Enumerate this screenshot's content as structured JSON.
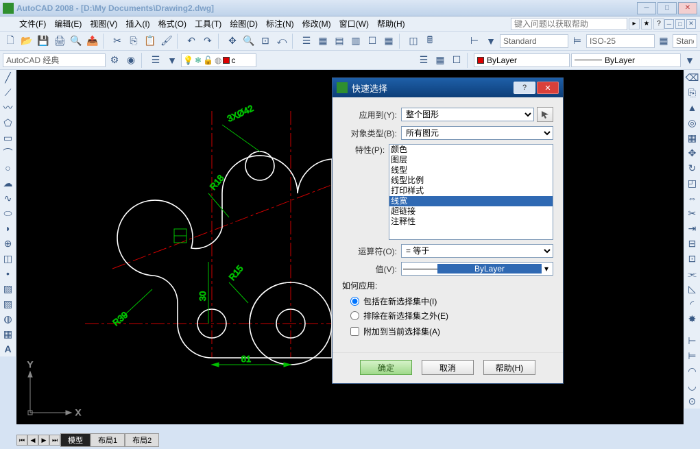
{
  "app": {
    "title": "AutoCAD 2008 - [D:\\My Documents\\Drawing2.dwg]"
  },
  "menu": {
    "items": [
      "文件(F)",
      "编辑(E)",
      "视图(V)",
      "插入(I)",
      "格式(O)",
      "工具(T)",
      "绘图(D)",
      "标注(N)",
      "修改(M)",
      "窗口(W)",
      "帮助(H)"
    ],
    "search_placeholder": "键入问题以获取帮助"
  },
  "toolbar2": {
    "workspace": "AutoCAD 经典",
    "layer_combo": "c",
    "bylayer1": "ByLayer",
    "bylayer2": "ByLayer"
  },
  "toolbar_right": {
    "style1": "Standard",
    "style2": "ISO-25",
    "style3": "Stand"
  },
  "tabs": {
    "model": "模型",
    "layout1": "布局1",
    "layout2": "布局2"
  },
  "drawing": {
    "axis_x": "X",
    "axis_y": "Y",
    "dim1": "81",
    "dim2": "30",
    "dim3": "3XØ42",
    "r18": "R18",
    "r15": "R15",
    "r39": "R39"
  },
  "dialog": {
    "title": "快速选择",
    "apply_to_label": "应用到(Y):",
    "apply_to_value": "整个图形",
    "obj_type_label": "对象类型(B):",
    "obj_type_value": "所有图元",
    "prop_label": "特性(P):",
    "props": [
      "颜色",
      "图层",
      "线型",
      "线型比例",
      "打印样式",
      "线宽",
      "超链接",
      "注释性"
    ],
    "props_selected_index": 5,
    "operator_label": "运算符(O):",
    "operator_value": "= 等于",
    "value_label": "值(V):",
    "value_value": "ByLayer",
    "how_label": "如何应用:",
    "radio1": "包括在新选择集中(I)",
    "radio2": "排除在新选择集之外(E)",
    "check1": "附加到当前选择集(A)",
    "btn_ok": "确定",
    "btn_cancel": "取消",
    "btn_help": "帮助(H)"
  },
  "colors": {
    "accent_green": "#00ff00",
    "dim_green": "#00c000",
    "canvas": "#000000"
  }
}
